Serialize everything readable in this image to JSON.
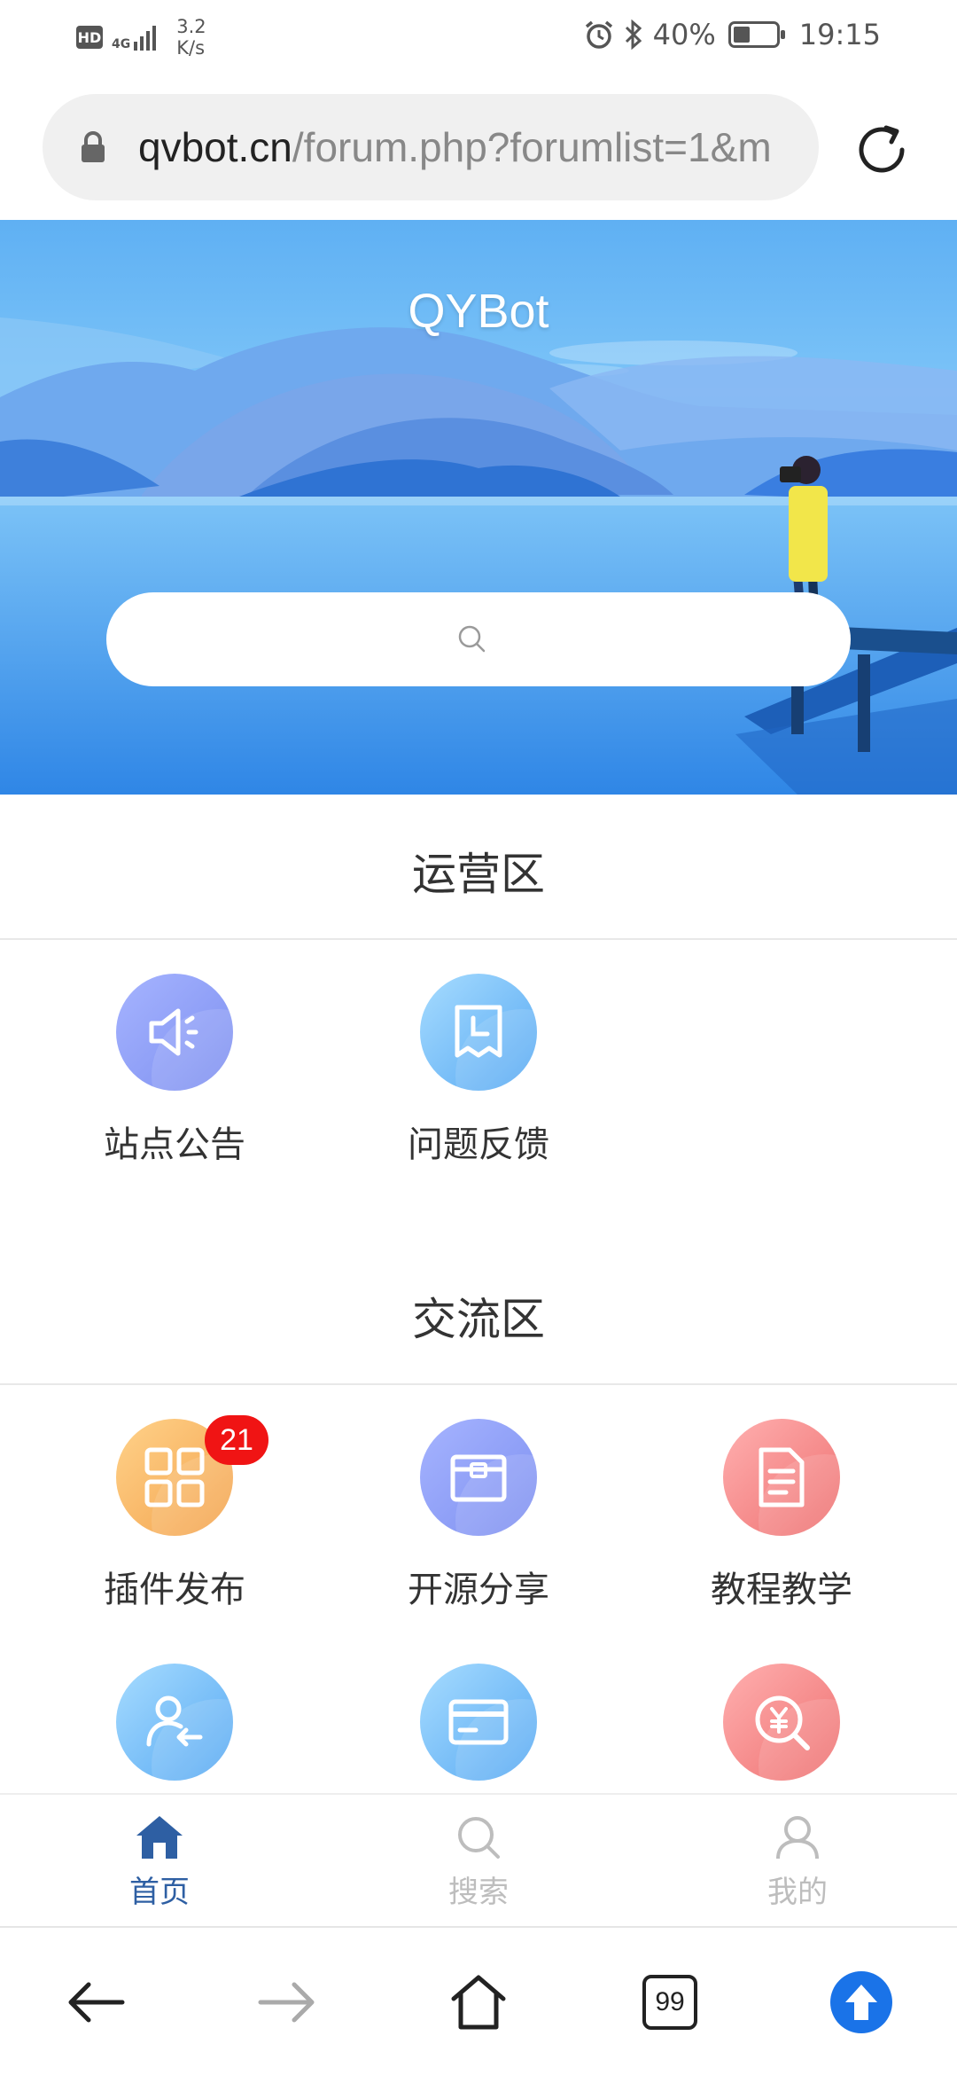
{
  "status_bar": {
    "hd": "HD",
    "network": "4G",
    "speed_value": "3.2",
    "speed_unit": "K/s",
    "battery_text": "40%",
    "battery_level": 0.4,
    "time": "19:15",
    "icons": [
      "alarm-icon",
      "bluetooth-icon",
      "battery-icon"
    ]
  },
  "browser": {
    "url_host": "qvbot.cn",
    "url_path": "/forum.php?forumlist=1&m",
    "reload_icon": "reload-icon"
  },
  "hero": {
    "site_title": "QYBot",
    "search_icon": "search-icon"
  },
  "sections": [
    {
      "title": "运营区",
      "forums": [
        {
          "label": "站点公告",
          "icon": "megaphone-icon",
          "color": "purple"
        },
        {
          "label": "问题反馈",
          "icon": "clock-ticket-icon",
          "color": "blue"
        }
      ]
    },
    {
      "title": "交流区",
      "forums": [
        {
          "label": "插件发布",
          "icon": "grid-icon",
          "color": "orange",
          "badge": "21"
        },
        {
          "label": "开源分享",
          "icon": "box-icon",
          "color": "purple"
        },
        {
          "label": "教程教学",
          "icon": "document-icon",
          "color": "red"
        },
        {
          "icon": "user-transfer-icon",
          "color": "blue"
        },
        {
          "icon": "card-icon",
          "color": "blue"
        },
        {
          "icon": "yen-search-icon",
          "color": "red"
        }
      ]
    }
  ],
  "tabbar": {
    "items": [
      {
        "label": "首页",
        "icon": "home-icon",
        "active": true
      },
      {
        "label": "搜索",
        "icon": "search-icon",
        "active": false
      },
      {
        "label": "我的",
        "icon": "user-icon",
        "active": false
      }
    ]
  },
  "browser_nav": {
    "tabs_count": "99",
    "icons": [
      "back-arrow-icon",
      "forward-arrow-icon",
      "home-outline-icon",
      "tabs-icon",
      "upload-icon"
    ]
  },
  "colors": {
    "accent": "#2e5fa3",
    "badge": "#f01414",
    "browser_blue": "#1a73e8",
    "hero_sky": "#5fb0f3"
  }
}
